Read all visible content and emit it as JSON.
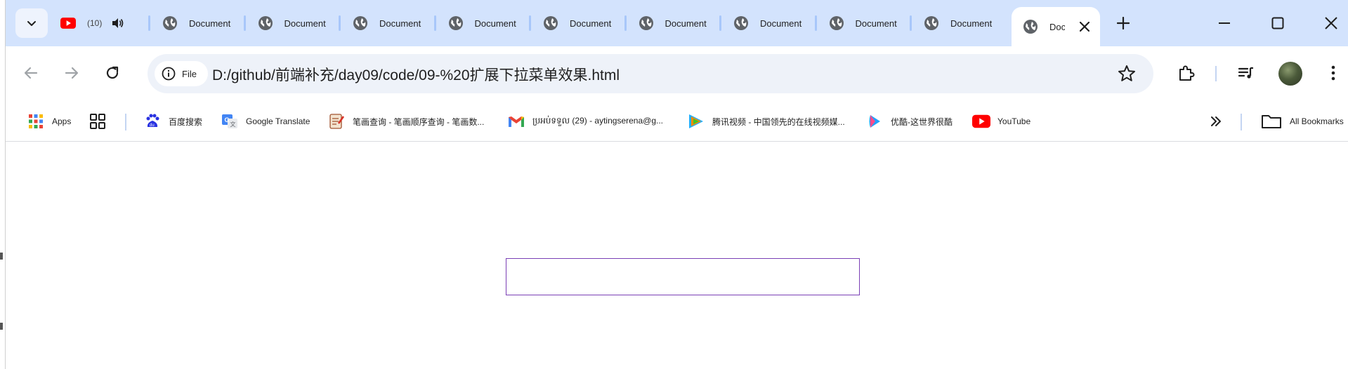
{
  "tabs": {
    "youtube": {
      "title": "(10) ",
      "icon": "youtube-icon"
    },
    "documents": [
      {
        "title": "Document"
      },
      {
        "title": "Document"
      },
      {
        "title": "Document"
      },
      {
        "title": "Document"
      },
      {
        "title": "Document"
      },
      {
        "title": "Document"
      },
      {
        "title": "Document"
      },
      {
        "title": "Document"
      },
      {
        "title": "Document"
      }
    ],
    "active": {
      "title": "Document"
    }
  },
  "toolbar": {
    "file_chip": "File",
    "url": "D:/github/前端补充/day09/code/09-%20扩展下拉菜单效果.html"
  },
  "bookmarks": {
    "apps": "Apps",
    "items": [
      {
        "label": "百度搜索",
        "icon": "baidu-icon"
      },
      {
        "label": "Google Translate",
        "icon": "google-translate-icon"
      },
      {
        "label": "笔画查询 - 笔画顺序查询 - 笔画数...",
        "icon": "notepad-icon"
      },
      {
        "label": "ប្រអប់ទទួល (29) - aytingserena@g...",
        "icon": "gmail-icon"
      },
      {
        "label": "腾讯视频 - 中国领先的在线视频媒...",
        "icon": "tencent-video-icon"
      },
      {
        "label": "优酷-这世界很酷",
        "icon": "youku-icon"
      },
      {
        "label": "YouTube",
        "icon": "youtube-icon"
      }
    ],
    "all_bookmarks": "All Bookmarks"
  },
  "colors": {
    "tabstrip": "#d3e3fd",
    "box_border": "#7a3fb5",
    "youtube_red": "#ff0000"
  }
}
